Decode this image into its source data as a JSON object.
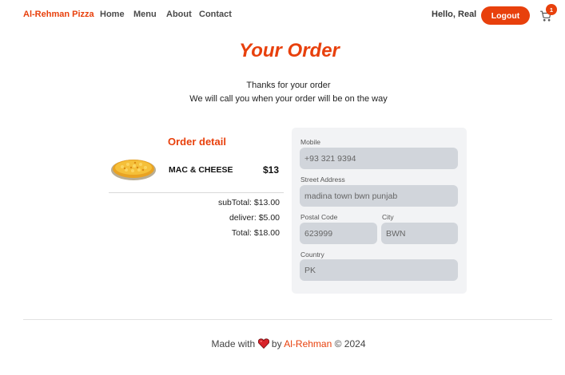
{
  "nav": {
    "brand": "Al-Rehman Pizza",
    "links": [
      "Home",
      "Menu",
      "About",
      "Contact"
    ],
    "greeting": "Hello, Real",
    "logout_label": "Logout",
    "cart_count": "1"
  },
  "header": {
    "title": "Your Order",
    "thanks_line1": "Thanks for your order",
    "thanks_line2": "We will call you when your order will be on the way"
  },
  "order": {
    "title": "Order detail",
    "items": [
      {
        "name": "MAC & CHEESE",
        "price": "$13"
      }
    ],
    "subtotal": "subTotal: $13.00",
    "delivery": "deliver: $5.00",
    "total": "Total: $18.00"
  },
  "form": {
    "mobile_label": "Mobile",
    "mobile_value": "+93 321 9394",
    "street_label": "Street Address",
    "street_value": "madina town bwn punjab",
    "postal_label": "Postal Code",
    "postal_value": "623999",
    "city_label": "City",
    "city_value": "BWN",
    "country_label": "Country",
    "country_value": "PK"
  },
  "footer": {
    "made_with": "Made with",
    "by": "by",
    "brand": "Al-Rehman",
    "copyright": "© 2024"
  },
  "colors": {
    "accent": "#e8400c",
    "card_bg": "#f2f3f5",
    "input_bg": "#d1d5db"
  }
}
